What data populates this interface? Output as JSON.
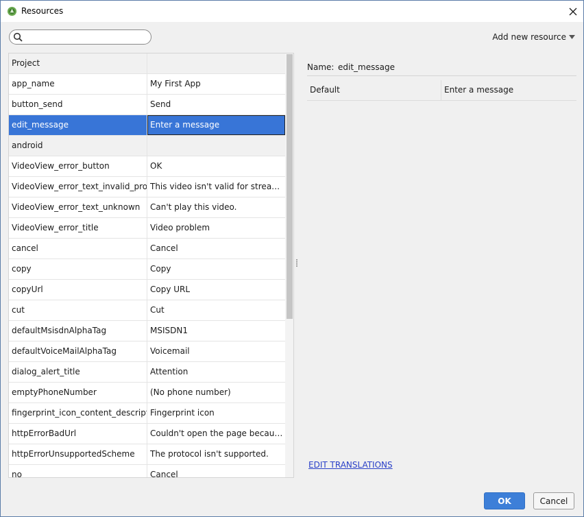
{
  "window": {
    "title": "Resources",
    "app_icon": "android-studio-icon",
    "close_icon": "close-icon"
  },
  "toolbar": {
    "search_value": "",
    "search_icon": "search-icon",
    "add_resource_label": "Add new resource",
    "add_resource_icon": "caret-down-icon"
  },
  "resources": {
    "rows": [
      {
        "name": "Project",
        "value": "",
        "group": true
      },
      {
        "name": "app_name",
        "value": "My First App"
      },
      {
        "name": "button_send",
        "value": "Send"
      },
      {
        "name": "edit_message",
        "value": "Enter a message",
        "selected": true
      },
      {
        "name": "android",
        "value": "",
        "group": true
      },
      {
        "name": "VideoView_error_button",
        "value": "OK"
      },
      {
        "name": "VideoView_error_text_invalid_progress",
        "value": "This video isn't valid for streaming to this device."
      },
      {
        "name": "VideoView_error_text_unknown",
        "value": "Can't play this video."
      },
      {
        "name": "VideoView_error_title",
        "value": "Video problem"
      },
      {
        "name": "cancel",
        "value": "Cancel"
      },
      {
        "name": "copy",
        "value": "Copy"
      },
      {
        "name": "copyUrl",
        "value": "Copy URL"
      },
      {
        "name": "cut",
        "value": "Cut"
      },
      {
        "name": "defaultMsisdnAlphaTag",
        "value": "MSISDN1"
      },
      {
        "name": "defaultVoiceMailAlphaTag",
        "value": "Voicemail"
      },
      {
        "name": "dialog_alert_title",
        "value": "Attention"
      },
      {
        "name": "emptyPhoneNumber",
        "value": "(No phone number)"
      },
      {
        "name": "fingerprint_icon_content_description",
        "value": "Fingerprint icon"
      },
      {
        "name": "httpErrorBadUrl",
        "value": "Couldn't open the page because the URL is invalid."
      },
      {
        "name": "httpErrorUnsupportedScheme",
        "value": "The protocol isn't supported."
      },
      {
        "name": "no",
        "value": "Cancel"
      }
    ]
  },
  "detail": {
    "name_label": "Name:",
    "name_value": "edit_message",
    "translations": [
      {
        "locale": "Default",
        "value": "Enter a message"
      }
    ],
    "edit_translations_label": "EDIT TRANSLATIONS"
  },
  "footer": {
    "ok_label": "OK",
    "cancel_label": "Cancel"
  },
  "colors": {
    "selection": "#3875d7",
    "ok_button": "#3d7fd8",
    "link": "#2a40c8"
  }
}
